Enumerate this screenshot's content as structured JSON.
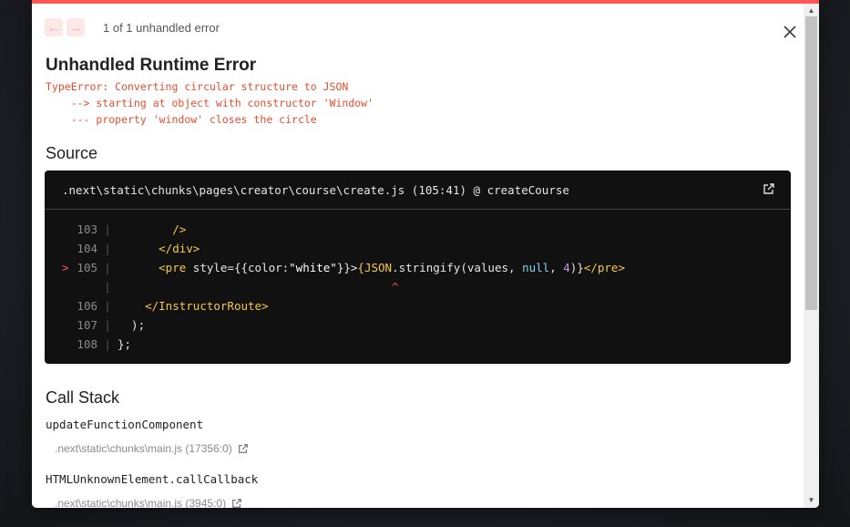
{
  "header": {
    "prev_icon": "arrow-left-icon",
    "next_icon": "arrow-right-icon",
    "pagination": "1 of 1 unhandled error",
    "close_icon": "close-icon"
  },
  "error": {
    "title": "Unhandled Runtime Error",
    "message_lines": [
      "TypeError: Converting circular structure to JSON",
      "    --> starting at object with constructor 'Window'",
      "    --- property 'window' closes the circle"
    ]
  },
  "source": {
    "heading": "Source",
    "file": ".next\\static\\chunks\\pages\\creator\\course\\create.js (105:41) @ createCourse",
    "open_icon": "external-link-icon",
    "lines": [
      {
        "num": "103",
        "marker": "",
        "tokens": [
          {
            "t": "        ",
            "c": "code"
          },
          {
            "t": "/>",
            "c": "tag"
          }
        ]
      },
      {
        "num": "104",
        "marker": "",
        "tokens": [
          {
            "t": "      ",
            "c": "code"
          },
          {
            "t": "</div>",
            "c": "tag"
          }
        ]
      },
      {
        "num": "105",
        "marker": ">",
        "tokens": [
          {
            "t": "      ",
            "c": "code"
          },
          {
            "t": "<pre",
            "c": "tag"
          },
          {
            "t": " style={{color:",
            "c": "code"
          },
          {
            "t": "\"white\"",
            "c": "str"
          },
          {
            "t": "}}>",
            "c": "code"
          },
          {
            "t": "{",
            "c": "tag"
          },
          {
            "t": "JSON",
            "c": "tag"
          },
          {
            "t": ".stringify(values, ",
            "c": "code"
          },
          {
            "t": "null",
            "c": "kw"
          },
          {
            "t": ", ",
            "c": "code"
          },
          {
            "t": "4",
            "c": "num"
          },
          {
            "t": ")}",
            "c": "code"
          },
          {
            "t": "</pre>",
            "c": "tag"
          }
        ]
      },
      {
        "num": "",
        "marker": "",
        "tokens": [
          {
            "t": "                                        ^",
            "c": "caret"
          }
        ]
      },
      {
        "num": "106",
        "marker": "",
        "tokens": [
          {
            "t": "    ",
            "c": "code"
          },
          {
            "t": "</InstructorRoute>",
            "c": "tag"
          }
        ]
      },
      {
        "num": "107",
        "marker": "",
        "tokens": [
          {
            "t": "  );",
            "c": "code"
          }
        ]
      },
      {
        "num": "108",
        "marker": "",
        "tokens": [
          {
            "t": "};",
            "c": "code"
          }
        ]
      }
    ]
  },
  "call_stack": {
    "heading": "Call Stack",
    "frames": [
      {
        "fn": "updateFunctionComponent",
        "file": ".next\\static\\chunks\\main.js (17356:0)"
      },
      {
        "fn": "HTMLUnknownElement.callCallback",
        "file": ".next\\static\\chunks\\main.js (3945:0)"
      }
    ]
  },
  "colors": {
    "accent": "#ff5555",
    "error_text": "#e54d2e",
    "code_bg": "#111111"
  }
}
